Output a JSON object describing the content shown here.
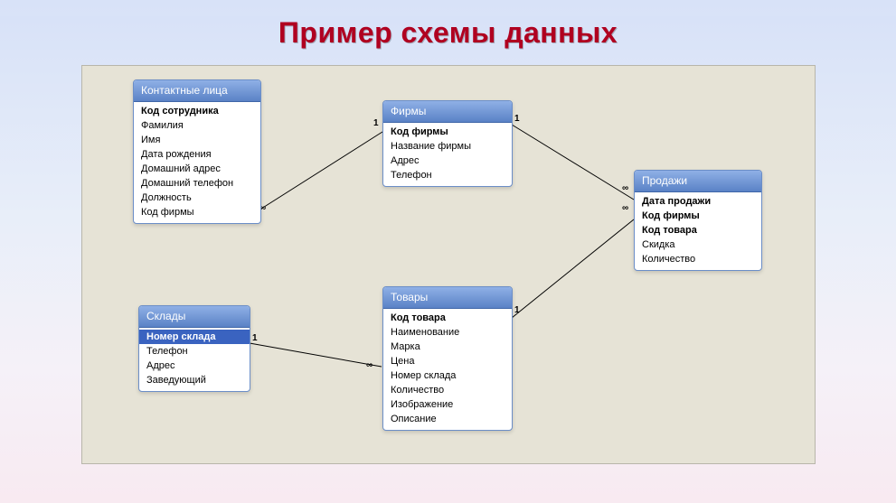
{
  "title": "Пример схемы данных",
  "tables": {
    "contacts": {
      "title": "Контактные лица",
      "fields": [
        {
          "label": "Код сотрудника",
          "pk": true
        },
        {
          "label": "Фамилия"
        },
        {
          "label": "Имя"
        },
        {
          "label": "Дата рождения"
        },
        {
          "label": "Домашний адрес"
        },
        {
          "label": "Домашний телефон"
        },
        {
          "label": "Должность"
        },
        {
          "label": "Код фирмы"
        }
      ]
    },
    "firms": {
      "title": "Фирмы",
      "fields": [
        {
          "label": "Код фирмы",
          "pk": true
        },
        {
          "label": "Название фирмы"
        },
        {
          "label": "Адрес"
        },
        {
          "label": "Телефон"
        }
      ]
    },
    "sales": {
      "title": "Продажи",
      "fields": [
        {
          "label": "Дата продажи",
          "pk": true
        },
        {
          "label": "Код фирмы",
          "pk": true
        },
        {
          "label": "Код товара",
          "pk": true
        },
        {
          "label": "Скидка"
        },
        {
          "label": "Количество"
        }
      ]
    },
    "warehouses": {
      "title": "Склады",
      "fields": [
        {
          "label": "Номер склада",
          "pk": true,
          "selected": true
        },
        {
          "label": "Телефон"
        },
        {
          "label": "Адрес"
        },
        {
          "label": "Заведующий"
        }
      ]
    },
    "goods": {
      "title": "Товары",
      "fields": [
        {
          "label": "Код товара",
          "pk": true
        },
        {
          "label": "Наименование"
        },
        {
          "label": "Марка"
        },
        {
          "label": "Цена"
        },
        {
          "label": "Номер склада"
        },
        {
          "label": "Количество"
        },
        {
          "label": "Изображение"
        },
        {
          "label": "Описание"
        }
      ]
    }
  },
  "cardinalities": {
    "contacts_firms_left": "∞",
    "contacts_firms_right": "1",
    "firms_sales_left": "1",
    "firms_sales_right": "∞",
    "warehouses_goods_left": "1",
    "warehouses_goods_right": "∞",
    "goods_sales_left": "1",
    "goods_sales_right": "∞"
  }
}
